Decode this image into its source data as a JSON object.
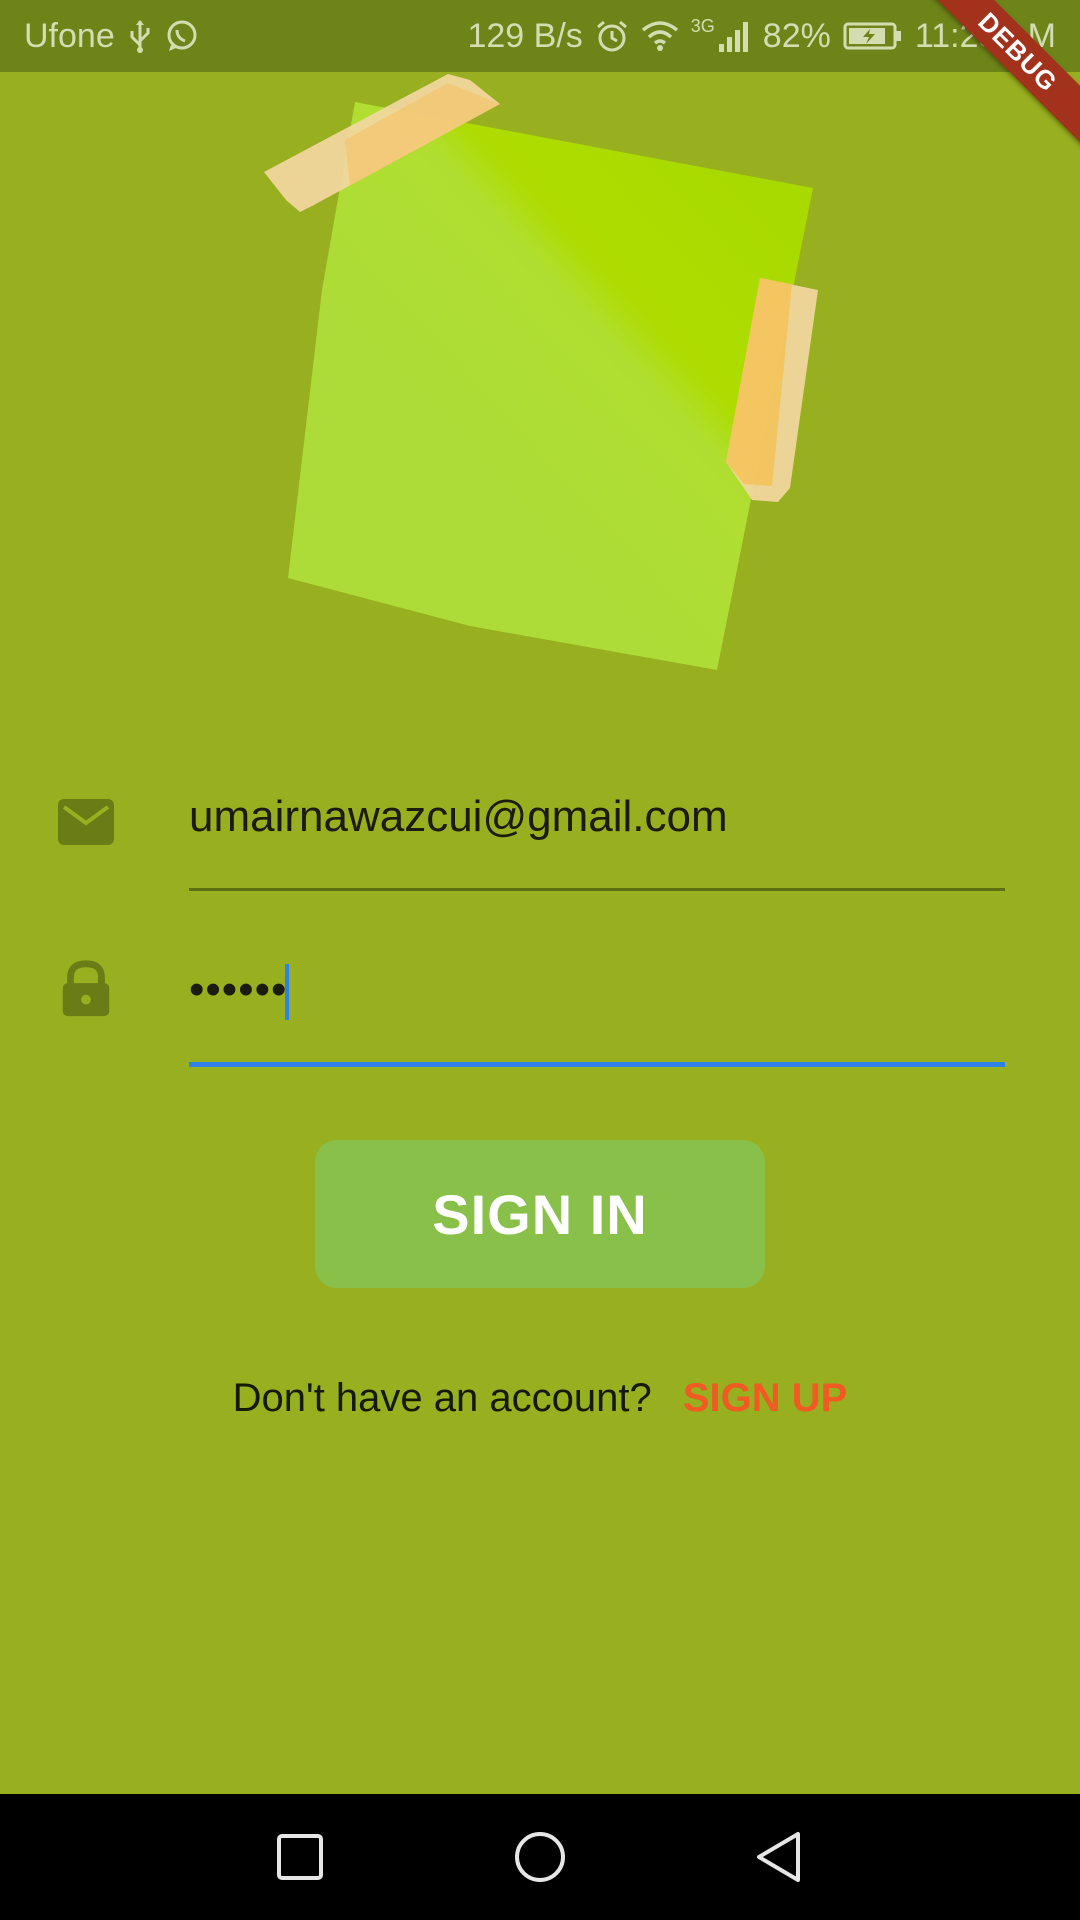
{
  "status_bar": {
    "carrier": "Ufone",
    "network_speed": "129 B/s",
    "network_type": "3G",
    "battery": "82%",
    "time": "11:23 AM",
    "icons": [
      "usb-icon",
      "whatsapp-icon",
      "alarm-icon",
      "wifi-icon",
      "signal-icon",
      "battery-charging-icon"
    ]
  },
  "debug_banner": {
    "label": "DEBUG"
  },
  "login_form": {
    "email": {
      "icon": "email-icon",
      "value": "umairnawazcui@gmail.com"
    },
    "password": {
      "icon": "lock-icon",
      "masked_value": "••••••",
      "focused": true
    },
    "sign_in_label": "SIGN IN",
    "signup_prompt": "Don't have an account?",
    "signup_label": "SIGN UP"
  },
  "nav_bar": {
    "buttons": [
      "recents-icon",
      "home-icon",
      "back-icon"
    ]
  },
  "colors": {
    "background": "#98AF1F",
    "status_bar": "#6E8419",
    "note": "#AEDC38",
    "tape": "#F0D79A",
    "button": "#88C04A",
    "signup_link": "#F05A23",
    "focus_underline": "#2F80E8",
    "debug_banner": "#A3321D"
  }
}
